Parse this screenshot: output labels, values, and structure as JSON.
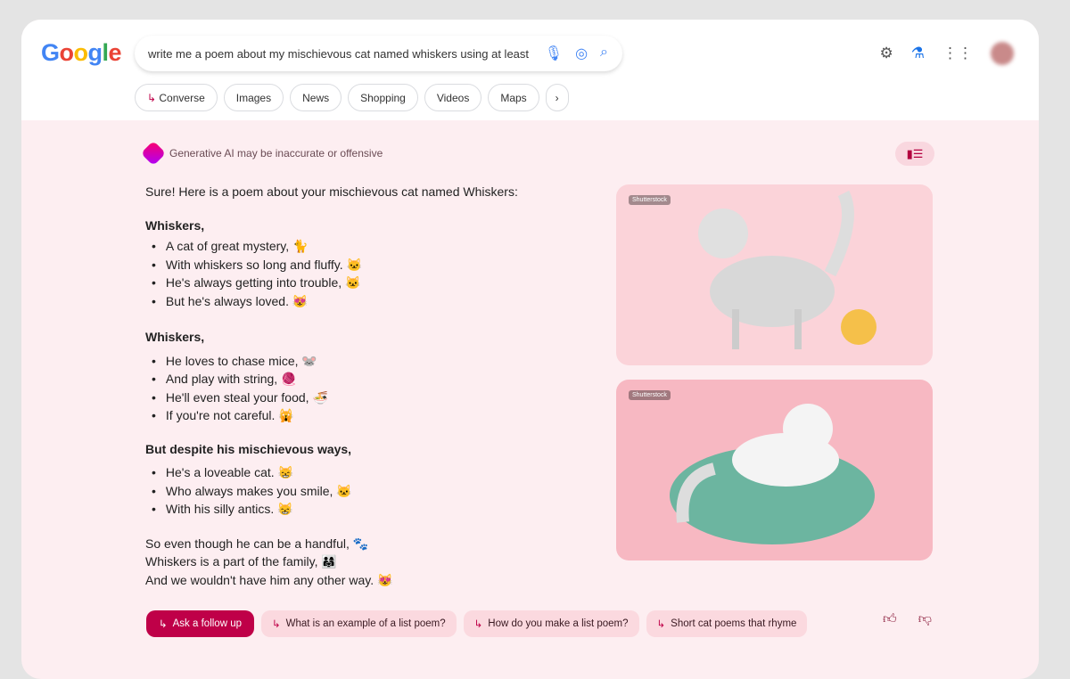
{
  "header": {
    "logo": "Google",
    "query": "write me a poem about my mischievous cat named whiskers using at least",
    "tabs": [
      "Converse",
      "Images",
      "News",
      "Shopping",
      "Videos",
      "Maps"
    ]
  },
  "disclaimer": "Generative AI may be inaccurate or offensive",
  "poem": {
    "intro": "Sure! Here is a poem about your mischievous cat named Whiskers:",
    "stanzas": [
      {
        "title": "Whiskers,",
        "lines": [
          "A cat of great mystery, 🐈",
          "With whiskers so long and fluffy. 🐱",
          "He's always getting into trouble, 🐱",
          "But he's always loved. 😻"
        ]
      },
      {
        "title": "Whiskers,",
        "lines": [
          "He loves to chase mice, 🐭",
          "And play with string, 🧶",
          "He'll even steal your food, 🍜",
          "If you're not careful. 🙀"
        ]
      },
      {
        "title": "But despite his mischievous ways,",
        "lines": [
          "He's a loveable cat. 😸",
          "Who always makes you smile, 🐱",
          "With his silly antics. 😸"
        ]
      }
    ],
    "ending": [
      "So even though he can be a handful, 🐾",
      "Whiskers is a part of the family, 👨‍👩‍👧",
      "And we wouldn't have him any other way. 😻"
    ]
  },
  "images": [
    {
      "source": "Shutterstock"
    },
    {
      "source": "Shutterstock"
    }
  ],
  "followups": {
    "primary": "Ask a follow up",
    "suggestions": [
      "What is an example of a list poem?",
      "How do you make a list poem?",
      "Short cat poems that rhyme"
    ]
  },
  "colors": {
    "accent": "#bf0048",
    "background": "#fdeef1"
  }
}
